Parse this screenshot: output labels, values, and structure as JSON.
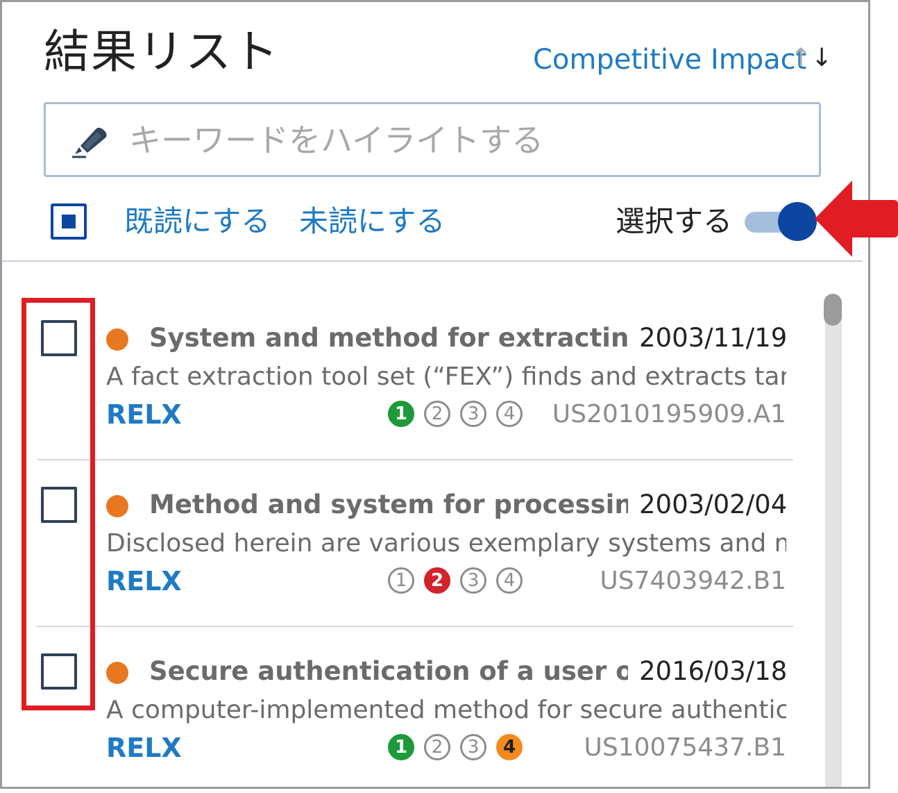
{
  "header": {
    "title": "結果リスト",
    "sort_label": "Competitive Impact",
    "sort_up": "↑",
    "sort_down": "↓"
  },
  "search": {
    "placeholder": "キーワードをハイライトする",
    "icon": "highlighter-pen-icon"
  },
  "actions": {
    "mark_read": "既読にする",
    "mark_unread": "未読にする",
    "select_label": "選択する",
    "select_toggle_on": true
  },
  "colors": {
    "accent": "#1f7ac4",
    "primary_dark": "#0d46a0",
    "unread_dot": "#e87722",
    "rank_green": "#1e9a3a",
    "rank_red": "#d2232a",
    "rank_orange": "#f58a1f",
    "annotation_red": "#e01d24"
  },
  "results": [
    {
      "title": "System and method for extracting inf...",
      "date": "2003/11/19",
      "snippet": "A fact extraction tool set (“FEX”) finds and extracts targ...",
      "company": "RELX",
      "ranks": [
        {
          "label": "1",
          "style": "green"
        },
        {
          "label": "2",
          "style": "outline"
        },
        {
          "label": "3",
          "style": "outline"
        },
        {
          "label": "4",
          "style": "outline"
        }
      ],
      "patent": "US2010195909.A1"
    },
    {
      "title": "Method and system for processing da...",
      "date": "2003/02/04",
      "snippet": "Disclosed herein are various exemplary systems and me...",
      "company": "RELX",
      "ranks": [
        {
          "label": "1",
          "style": "outline"
        },
        {
          "label": "2",
          "style": "red"
        },
        {
          "label": "3",
          "style": "outline"
        },
        {
          "label": "4",
          "style": "outline"
        }
      ],
      "patent": "US7403942.B1"
    },
    {
      "title": "Secure authentication of a user of a d...",
      "date": "2016/03/18",
      "snippet": "A computer-implemented method for secure authentic...",
      "company": "RELX",
      "ranks": [
        {
          "label": "1",
          "style": "green"
        },
        {
          "label": "2",
          "style": "outline"
        },
        {
          "label": "3",
          "style": "outline"
        },
        {
          "label": "4",
          "style": "orange"
        }
      ],
      "patent": "US10075437.B1"
    }
  ]
}
